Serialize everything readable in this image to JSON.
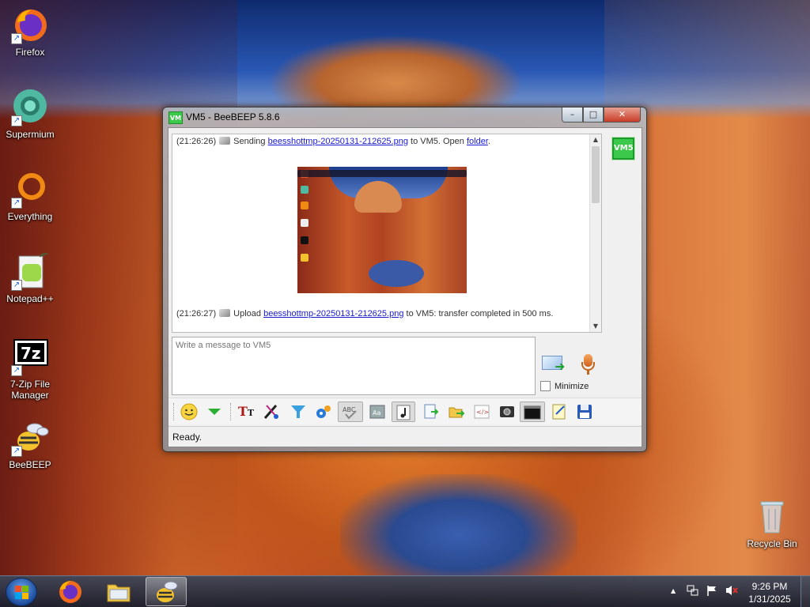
{
  "desktop": {
    "icons": [
      {
        "label": "Firefox"
      },
      {
        "label": "Supermium"
      },
      {
        "label": "Everything"
      },
      {
        "label": "Notepad++"
      },
      {
        "label": "7-Zip File Manager"
      },
      {
        "label": "BeeBEEP"
      },
      {
        "label": "Recycle Bin"
      }
    ]
  },
  "window": {
    "app_icon_text": "VM",
    "title": "VM5 - BeeBEEP 5.8.6",
    "controls": {
      "minimize": "–",
      "maximize": "□",
      "close": "✕"
    }
  },
  "chat": {
    "line1": {
      "timestamp": "(21:26:26)",
      "prefix": "Sending",
      "file": "beesshottmp-20250131-212625.png",
      "middle": "to VM5. Open",
      "link": "folder",
      "suffix": "."
    },
    "line2": {
      "timestamp": "(21:26:27)",
      "prefix": "Upload",
      "file": "beesshottmp-20250131-212625.png",
      "suffix": "to VM5: transfer completed in 500 ms."
    }
  },
  "composer": {
    "placeholder": "Write a message to VM5",
    "minimize_label": "Minimize"
  },
  "sidebar": {
    "user_button": "VM5"
  },
  "toolbar": {
    "buttons": [
      "emoticon-icon",
      "green-down-arrow-icon",
      "font-icon",
      "color-pen-icon",
      "filter-icon",
      "settings-gears-icon",
      "spellcheck-icon",
      "text-box-icon",
      "music-note-icon",
      "send-file-icon",
      "send-folder-icon",
      "code-icon",
      "screenshot-icon",
      "terminal-icon",
      "notes-icon",
      "save-icon"
    ]
  },
  "status": {
    "text": "Ready."
  },
  "taskbar": {
    "clock_time": "9:26 PM",
    "clock_date": "1/31/2025",
    "tray_up_arrow": "▲"
  }
}
